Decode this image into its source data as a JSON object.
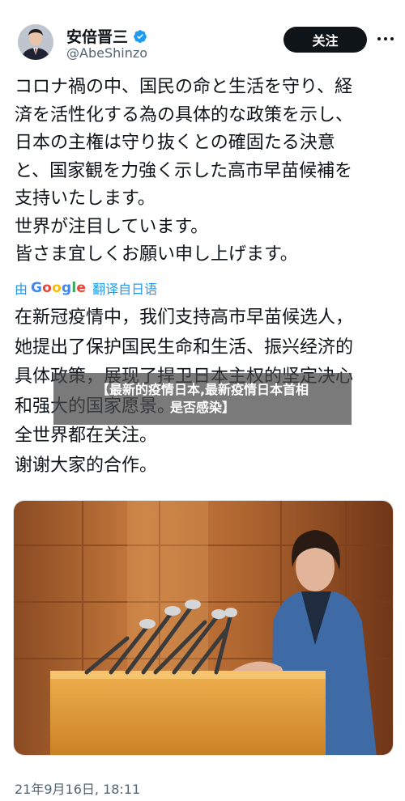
{
  "author": {
    "display_name": "安倍晋三",
    "handle": "@AbeShinzo"
  },
  "actions": {
    "follow_label": "关注"
  },
  "tweet": {
    "original_text": "コロナ禍の中、国民の命と生活を守り、経\n済を活性化する為の具体的な政策を示し、\n日本の主権は守り抜くとの確固たる決意\nと、国家観を力強く示した高市早苗候補を\n支持いたします。\n世界が注目しています。\n皆さま宜しくお願い申し上げます。",
    "translation": {
      "by_label": "由",
      "provider": "Google",
      "link_label": "翻译自日语"
    },
    "translated_text": "在新冠疫情中，我们支持高市早苗候选人，\n她提出了保护国民生命和生活、振兴经济的\n具体政策，展现了捍卫日本主权的坚定决心\n和强大的国家愿景。\n全世界都在关注。\n谢谢大家的合作。",
    "timestamp": "21年9月16日, 18:11"
  },
  "overlay": {
    "line1": "【最新的疫情日本,最新疫情日本首相",
    "line2": "是否感染】"
  },
  "colors": {
    "link": "#1d9bf0",
    "verified": "#1d9bf0",
    "button_bg": "#0f1419",
    "google": [
      "#4285F4",
      "#EA4335",
      "#FBBC05",
      "#4285F4",
      "#34A853",
      "#EA4335"
    ]
  },
  "icons": {
    "verified": "verified-badge-icon",
    "more": "more-dots-icon"
  }
}
